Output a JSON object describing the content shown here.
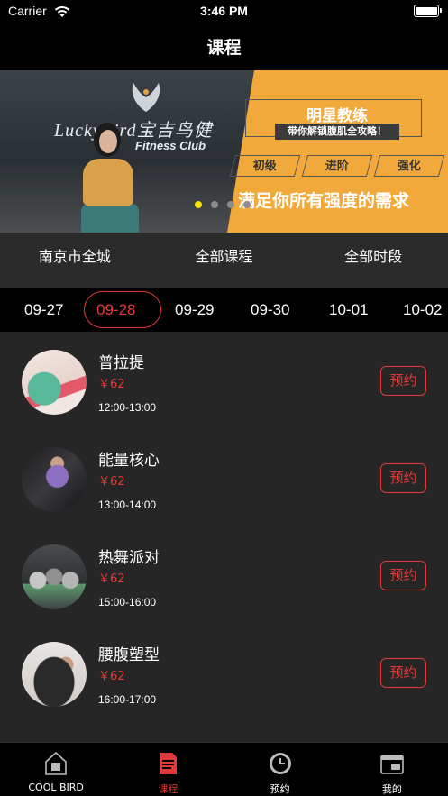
{
  "status_bar": {
    "carrier": "Carrier",
    "time": "3:46 PM"
  },
  "nav": {
    "title": "课程"
  },
  "banner": {
    "gym_sign": "LuckyBird宝吉鸟健",
    "gym_sign_sub": "Fitness Club",
    "panel_title": "明星教练",
    "panel_subtitle": "带你解锁腹肌全攻略！",
    "levels": [
      "初级",
      "进阶",
      "强化"
    ],
    "slogan": "满足你所有强度的需求",
    "active_dot": 0
  },
  "filters": [
    "南京市全城",
    "全部课程",
    "全部时段"
  ],
  "dates": {
    "items": [
      "09-27",
      "09-28",
      "09-29",
      "09-30",
      "10-01",
      "10-02"
    ],
    "selected_index": 1
  },
  "courses": [
    {
      "name": "普拉提",
      "price": "￥62",
      "time": "12:00-13:00",
      "button": "预约"
    },
    {
      "name": "能量核心",
      "price": "￥62",
      "time": "13:00-14:00",
      "button": "预约"
    },
    {
      "name": "热舞派对",
      "price": "￥62",
      "time": "15:00-16:00",
      "button": "预约"
    },
    {
      "name": "腰腹塑型",
      "price": "￥62",
      "time": "16:00-17:00",
      "button": "预约"
    }
  ],
  "tabbar": {
    "items": [
      {
        "label": "COOL BIRD",
        "icon": "home-icon"
      },
      {
        "label": "课程",
        "icon": "document-icon"
      },
      {
        "label": "预约",
        "icon": "clock-icon"
      },
      {
        "label": "我的",
        "icon": "wallet-icon"
      }
    ],
    "active_index": 1
  },
  "colors": {
    "accent": "#e23a3a",
    "background": "#262626",
    "bar": "#000000",
    "banner_panel": "#f2a93b",
    "dot_active": "#f5e300"
  }
}
